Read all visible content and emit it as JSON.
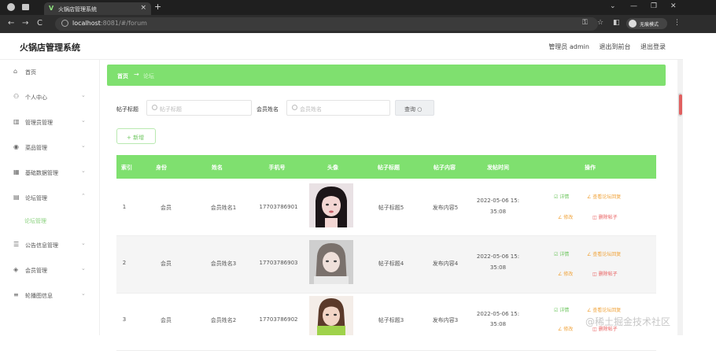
{
  "browser": {
    "tab_title": "火锅店管理系统",
    "tab_close": "×",
    "new_tab": "+",
    "url_host": "localhost",
    "url_rest": ":8081/#/forum",
    "incognito_label": "无痕模式",
    "win_minimize": "—",
    "win_restore": "❐",
    "win_close": "✕",
    "win_chevron": "⌄"
  },
  "app": {
    "title": "火锅店管理系统",
    "header_links": {
      "admin": "管理员 admin",
      "to_front": "退出到前台",
      "logout": "退出登录"
    }
  },
  "sidebar": {
    "items": [
      {
        "label": "首页",
        "icon": "home-icon",
        "glyph": "⌂"
      },
      {
        "label": "个人中心",
        "icon": "user-icon",
        "glyph": "⚇"
      },
      {
        "label": "管理员管理",
        "icon": "bar-chart-icon",
        "glyph": "▥"
      },
      {
        "label": "菜品管理",
        "icon": "pin-icon",
        "glyph": "◉"
      },
      {
        "label": "基础数据管理",
        "icon": "grid-icon",
        "glyph": "▦"
      },
      {
        "label": "论坛管理",
        "icon": "chat-icon",
        "glyph": "▤"
      },
      {
        "label": "公告信息管理",
        "icon": "notice-icon",
        "glyph": "☰"
      },
      {
        "label": "会员管理",
        "icon": "member-icon",
        "glyph": "◈"
      },
      {
        "label": "轮播图信息",
        "icon": "list-icon",
        "glyph": "≡"
      }
    ],
    "sub_active": "论坛管理"
  },
  "breadcrumb": {
    "home": "首页",
    "arrow": "→",
    "current": "论坛"
  },
  "filters": {
    "title_label": "帖子标题",
    "title_placeholder": "帖子标题",
    "member_label": "会员姓名",
    "member_placeholder": "会员姓名",
    "search_button": "查询 ○",
    "add_button": "+ 新增"
  },
  "table": {
    "headers": [
      "索引",
      "身份",
      "姓名",
      "手机号",
      "头像",
      "帖子标题",
      "帖子内容",
      "发帖时间",
      "操作"
    ],
    "rows": [
      {
        "index": "1",
        "role": "会员",
        "name": "会员姓名1",
        "phone": "17703786901",
        "post_title": "帖子标题5",
        "post_content": "发布内容5",
        "time1": "2022-05-06 15:",
        "time2": "35:08"
      },
      {
        "index": "2",
        "role": "会员",
        "name": "会员姓名3",
        "phone": "17703786903",
        "post_title": "帖子标题4",
        "post_content": "发布内容4",
        "time1": "2022-05-06 15:",
        "time2": "35:08"
      },
      {
        "index": "3",
        "role": "会员",
        "name": "会员姓名2",
        "phone": "17703786902",
        "post_title": "帖子标题3",
        "post_content": "发布内容3",
        "time1": "2022-05-06 15:",
        "time2": "35:08"
      }
    ],
    "actions": {
      "detail": "☑ 详情",
      "view_reply": "∠ 查看论坛回复",
      "edit": "∠ 修改",
      "delete": "◫ 删除帖子"
    }
  },
  "watermark": "@稀土掘金技术社区",
  "colors": {
    "accent": "#7fe06f",
    "edit": "#f0a33a",
    "delete": "#e85d5d"
  }
}
